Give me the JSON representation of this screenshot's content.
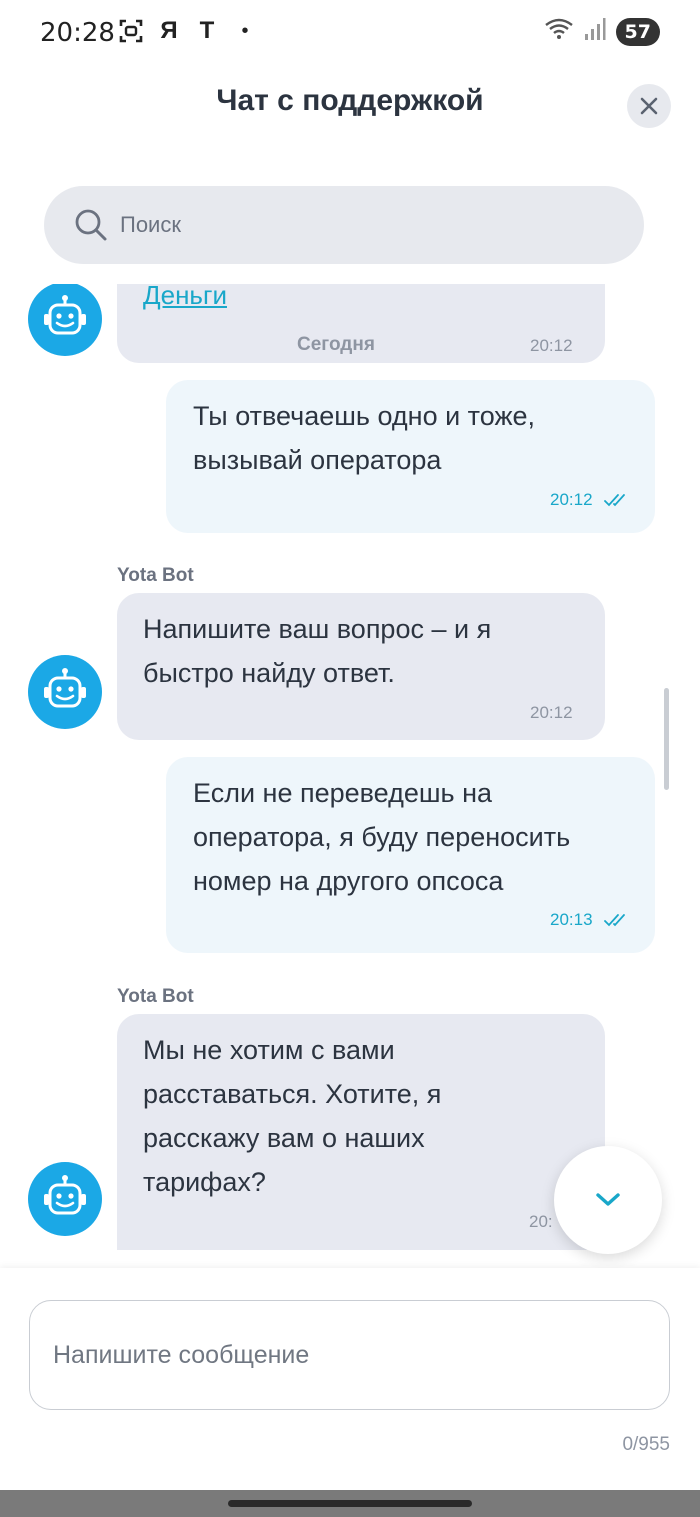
{
  "status_bar": {
    "time": "20:28",
    "icons": [
      "screenshot-icon",
      "yandex-icon",
      "tbank-icon",
      "dot-icon"
    ],
    "ya_glyph": "Я",
    "t_glyph": "T",
    "dot_glyph": "•",
    "battery": "57"
  },
  "header": {
    "title": "Чат с поддержкой",
    "close_glyph": "✕"
  },
  "search": {
    "placeholder": "Поиск"
  },
  "messages": [
    {
      "from": "bot",
      "link": "Деньги",
      "date_label": "Сегодня",
      "time": "20:12"
    },
    {
      "from": "user",
      "text": "Ты отвечаешь одно и тоже, вызывай оператора",
      "lines": [
        "Ты отвечаешь одно и тоже,",
        "вызывай оператора"
      ],
      "time": "20:12",
      "status": "read"
    },
    {
      "from": "bot",
      "sender": "Yota Bot",
      "lines": [
        "Напишите ваш вопрос – и я",
        "быстро найду ответ."
      ],
      "time": "20:12"
    },
    {
      "from": "user",
      "lines": [
        "Если не переведешь на",
        "оператора, я буду переносить",
        "номер на другого опсоса"
      ],
      "time": "20:13",
      "status": "read"
    },
    {
      "from": "bot",
      "sender": "Yota Bot",
      "lines": [
        "Мы не хотим с вами",
        "расставаться. Хотите, я",
        "расскажу вам о наших",
        "тарифах?"
      ],
      "time": "20:"
    }
  ],
  "composer": {
    "placeholder": "Напишите сообщение",
    "counter": "0/955"
  },
  "colors": {
    "accent": "#19a7c9",
    "avatar_bg": "#1ba8e6",
    "bot_bubble": "#e7e9f1",
    "user_bubble": "#eef6fb"
  }
}
